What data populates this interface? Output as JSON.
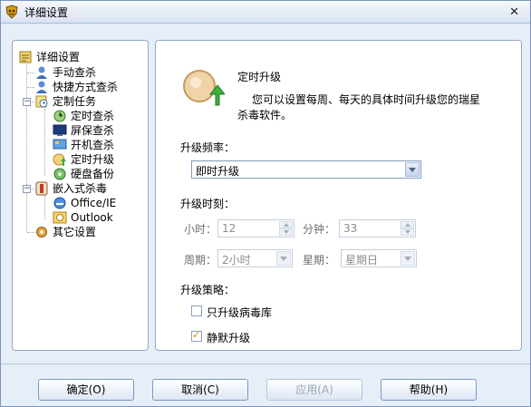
{
  "window": {
    "title": "详细设置"
  },
  "tree": {
    "root": "详细设置",
    "items": [
      {
        "label": "手动查杀",
        "icon": "user-icon"
      },
      {
        "label": "快捷方式查杀",
        "icon": "user-icon"
      },
      {
        "label": "定制任务",
        "icon": "scheduled-task-icon"
      },
      {
        "label": "定时查杀",
        "icon": "clock-scan-icon"
      },
      {
        "label": "屏保查杀",
        "icon": "screensaver-icon"
      },
      {
        "label": "开机查杀",
        "icon": "startup-icon"
      },
      {
        "label": "定时升级",
        "icon": "upgrade-icon"
      },
      {
        "label": "硬盘备份",
        "icon": "disk-backup-icon"
      },
      {
        "label": "嵌入式杀毒",
        "icon": "embedded-antivirus-icon"
      },
      {
        "label": "Office/IE",
        "icon": "office-ie-icon"
      },
      {
        "label": "Outlook",
        "icon": "outlook-icon"
      },
      {
        "label": "其它设置",
        "icon": "gear-icon"
      }
    ]
  },
  "content": {
    "heading": "定时升级",
    "description_line1": "您可以设置每周、每天的具体时间升级您的瑞星",
    "description_line2": "杀毒软件。",
    "frequency_label": "升级频率：",
    "frequency_value": "即时升级",
    "time_label": "升级时刻：",
    "hour_label": "小时：",
    "hour_value": "12",
    "minute_label": "分钟：",
    "minute_value": "33",
    "period_label": "周期：",
    "period_value": "2小时",
    "weekday_label": "星期：",
    "weekday_value": "星期日",
    "strategy_label": "升级策略：",
    "only_virus_db_label": "只升级病毒库",
    "only_virus_db_checked": false,
    "silent_label": "静默升级",
    "silent_checked": true
  },
  "buttons": {
    "ok": "确定(O)",
    "cancel": "取消(C)",
    "apply": "应用(A)",
    "help": "帮助(H)"
  },
  "colors": {
    "accent": "#7a95bd",
    "background": "#e6eef8",
    "check": "#d58a00"
  }
}
